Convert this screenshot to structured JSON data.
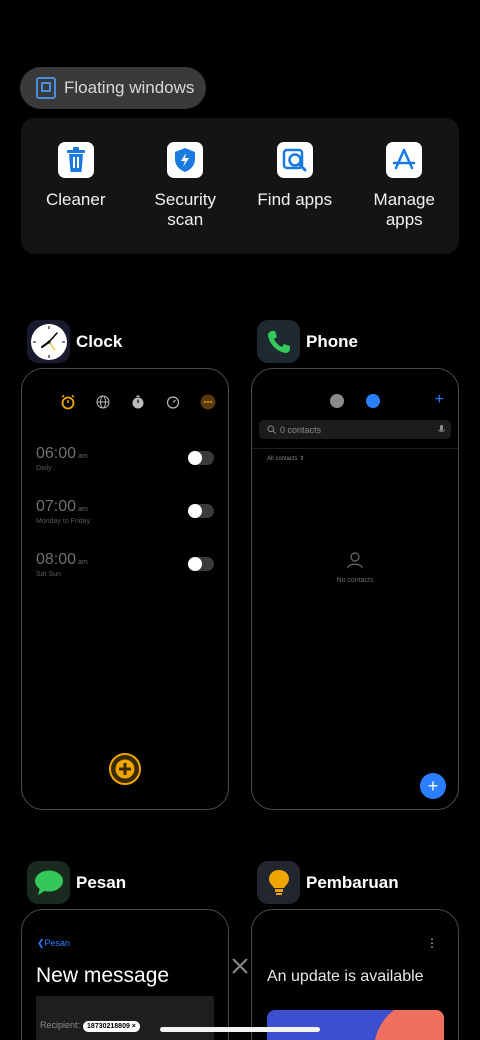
{
  "floating_windows": {
    "label": "Floating windows"
  },
  "tools": [
    {
      "label": "Cleaner",
      "icon": "trash-icon"
    },
    {
      "label": "Security\nscan",
      "icon": "shield-bolt-icon"
    },
    {
      "label": "Find apps",
      "icon": "magnifier-app-icon"
    },
    {
      "label": "Manage\napps",
      "icon": "app-store-icon"
    }
  ],
  "clock": {
    "name": "Clock",
    "alarms": [
      {
        "time": "06:00",
        "ampm": "am",
        "repeat": "Daily"
      },
      {
        "time": "07:00",
        "ampm": "am",
        "repeat": "Monday to Friday"
      },
      {
        "time": "08:00",
        "ampm": "am",
        "repeat": "Sat Sun"
      }
    ]
  },
  "phone": {
    "name": "Phone",
    "search_placeholder": "0 contacts",
    "filter": "All contacts",
    "empty_label": "No contacts"
  },
  "pesan": {
    "name": "Pesan",
    "back_label": "Pesan",
    "title": "New message",
    "recipient_label": "Recipient:",
    "recipient_chip": "18730218809"
  },
  "pembaruan": {
    "name": "Pembaruan",
    "title": "An update is available"
  },
  "colors": {
    "accent_blue": "#2a7fff",
    "clock_orange": "#f0a500",
    "phone_green": "#34c759",
    "pesan_green": "#34c759"
  }
}
